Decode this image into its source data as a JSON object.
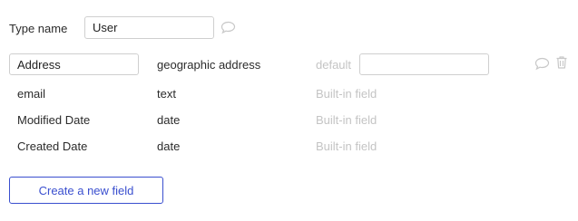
{
  "type_name": {
    "label": "Type name",
    "value": "User",
    "comment_icon": "speech-bubble-icon"
  },
  "fields": [
    {
      "name": "Address",
      "type": "geographic address",
      "default_label": "default",
      "default_value": "",
      "editable": true,
      "icons": [
        "speech-bubble-icon",
        "trash-icon"
      ]
    },
    {
      "name": "email",
      "type": "text",
      "note": "Built-in field"
    },
    {
      "name": "Modified Date",
      "type": "date",
      "note": "Built-in field"
    },
    {
      "name": "Created Date",
      "type": "date",
      "note": "Built-in field"
    }
  ],
  "create_button": {
    "label": "Create a new field"
  },
  "colors": {
    "accent": "#3a4fcf",
    "muted_text": "#c4c4c4",
    "border": "#cfcfcf",
    "icon": "#c8c8c8"
  }
}
